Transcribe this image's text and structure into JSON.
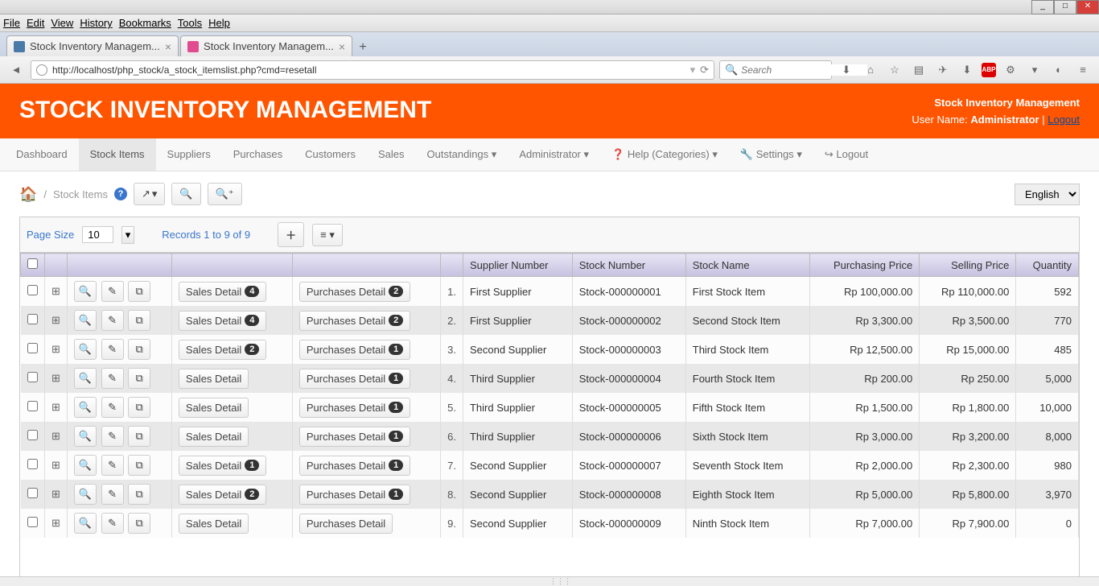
{
  "os": {
    "menu": [
      "File",
      "Edit",
      "View",
      "History",
      "Bookmarks",
      "Tools",
      "Help"
    ]
  },
  "tabs": [
    {
      "title": "Stock Inventory Managem...",
      "icon_bg": "#4a7aa8"
    },
    {
      "title": "Stock Inventory Managem...",
      "icon_bg": "#e04c8f"
    }
  ],
  "url": "http://localhost/php_stock/a_stock_itemslist.php?cmd=resetall",
  "search_placeholder": "Search",
  "header": {
    "title": "STOCK INVENTORY MANAGEMENT",
    "product": "Stock Inventory Management",
    "user_label": "User Name:",
    "user": "Administrator",
    "logout": "Logout"
  },
  "nav": [
    "Dashboard",
    "Stock Items",
    "Suppliers",
    "Purchases",
    "Customers",
    "Sales",
    "Outstandings",
    "Administrator",
    "Help (Categories)",
    "Settings",
    "Logout"
  ],
  "breadcrumb": "Stock Items",
  "lang": "English",
  "gridbar": {
    "page_size_label": "Page Size",
    "page_size": "10",
    "records": "Records 1 to 9 of 9"
  },
  "columns": [
    "Supplier Number",
    "Stock Number",
    "Stock Name",
    "Purchasing Price",
    "Selling Price",
    "Quantity"
  ],
  "detail_labels": {
    "sales": "Sales Detail",
    "purchases": "Purchases Detail"
  },
  "rows": [
    {
      "sales": "4",
      "purch": "2",
      "idx": "1.",
      "supplier": "First Supplier",
      "stock": "Stock-000000001",
      "name": "First Stock Item",
      "buy": "Rp 100,000.00",
      "sell": "Rp 110,000.00",
      "qty": "592"
    },
    {
      "sales": "4",
      "purch": "2",
      "idx": "2.",
      "supplier": "First Supplier",
      "stock": "Stock-000000002",
      "name": "Second Stock Item",
      "buy": "Rp 3,300.00",
      "sell": "Rp 3,500.00",
      "qty": "770"
    },
    {
      "sales": "2",
      "purch": "1",
      "idx": "3.",
      "supplier": "Second Supplier",
      "stock": "Stock-000000003",
      "name": "Third Stock Item",
      "buy": "Rp 12,500.00",
      "sell": "Rp 15,000.00",
      "qty": "485"
    },
    {
      "sales": "",
      "purch": "1",
      "idx": "4.",
      "supplier": "Third Supplier",
      "stock": "Stock-000000004",
      "name": "Fourth Stock Item",
      "buy": "Rp 200.00",
      "sell": "Rp 250.00",
      "qty": "5,000"
    },
    {
      "sales": "",
      "purch": "1",
      "idx": "5.",
      "supplier": "Third Supplier",
      "stock": "Stock-000000005",
      "name": "Fifth Stock Item",
      "buy": "Rp 1,500.00",
      "sell": "Rp 1,800.00",
      "qty": "10,000"
    },
    {
      "sales": "",
      "purch": "1",
      "idx": "6.",
      "supplier": "Third Supplier",
      "stock": "Stock-000000006",
      "name": "Sixth Stock Item",
      "buy": "Rp 3,000.00",
      "sell": "Rp 3,200.00",
      "qty": "8,000"
    },
    {
      "sales": "1",
      "purch": "1",
      "idx": "7.",
      "supplier": "Second Supplier",
      "stock": "Stock-000000007",
      "name": "Seventh Stock Item",
      "buy": "Rp 2,000.00",
      "sell": "Rp 2,300.00",
      "qty": "980"
    },
    {
      "sales": "2",
      "purch": "1",
      "idx": "8.",
      "supplier": "Second Supplier",
      "stock": "Stock-000000008",
      "name": "Eighth Stock Item",
      "buy": "Rp 5,000.00",
      "sell": "Rp 5,800.00",
      "qty": "3,970"
    },
    {
      "sales": "",
      "purch": "",
      "idx": "9.",
      "supplier": "Second Supplier",
      "stock": "Stock-000000009",
      "name": "Ninth Stock Item",
      "buy": "Rp 7,000.00",
      "sell": "Rp 7,900.00",
      "qty": "0"
    }
  ]
}
